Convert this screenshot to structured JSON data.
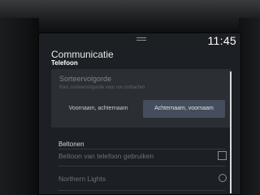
{
  "status_bar": {
    "clock": "11:45"
  },
  "header": {
    "title": "Communicatie",
    "subtitle": "Telefoon"
  },
  "sort_order": {
    "heading": "Sorteervolgorde",
    "description": "Kies sorteervolgorde voor uw contacten",
    "options": [
      {
        "label": "Voornaam, achternaam",
        "selected": false
      },
      {
        "label": "Achternaam, voornaam",
        "selected": true
      }
    ]
  },
  "ringtones": {
    "section_label": "Beltonen",
    "items": [
      {
        "label": "Beltoon van telefoon gebruiken",
        "control": "checkbox",
        "checked": false
      },
      {
        "label": "Northern Lights",
        "control": "radio",
        "checked": false
      }
    ]
  },
  "colors": {
    "accent_selected": "#434d5b",
    "card": "#2b2f34",
    "background": "#1c1f23"
  }
}
